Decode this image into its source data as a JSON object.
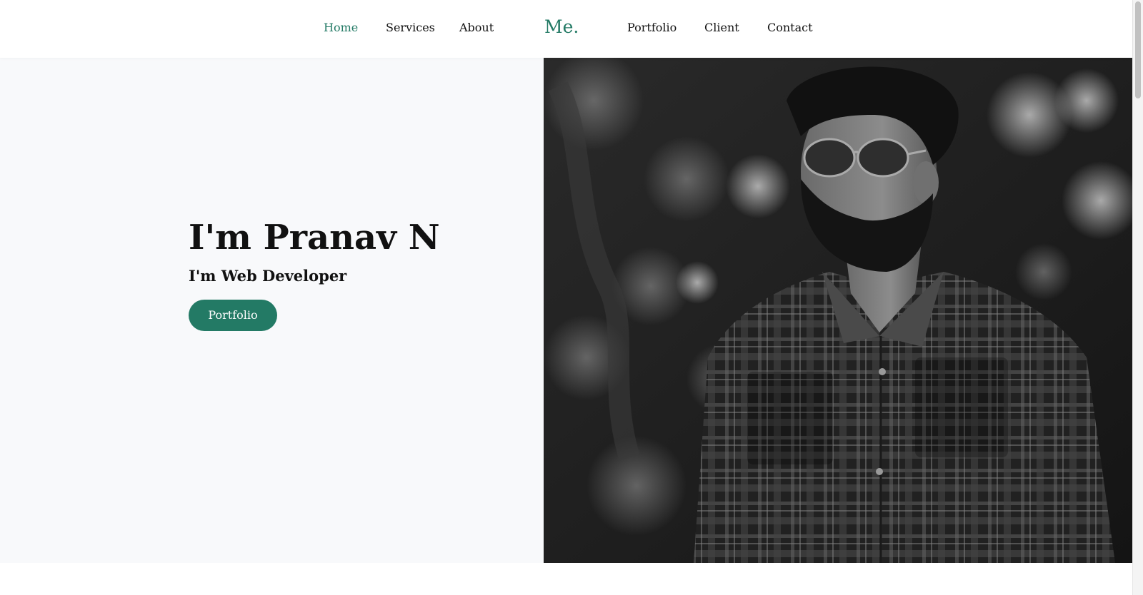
{
  "nav": {
    "items": [
      {
        "label": "Home",
        "active": true
      },
      {
        "label": "Services",
        "active": false
      },
      {
        "label": "About",
        "active": false
      },
      {
        "label": "Portfolio",
        "active": false
      },
      {
        "label": "Client",
        "active": false
      },
      {
        "label": "Contact",
        "active": false
      }
    ],
    "brand": "Me."
  },
  "hero": {
    "title": "I'm Pranav N",
    "subtitle": "I'm Web Developer",
    "button_label": "Portfolio"
  },
  "theme": {
    "accent": "#237a65",
    "text": "#111111",
    "hero_background": "#f8f9fb"
  }
}
